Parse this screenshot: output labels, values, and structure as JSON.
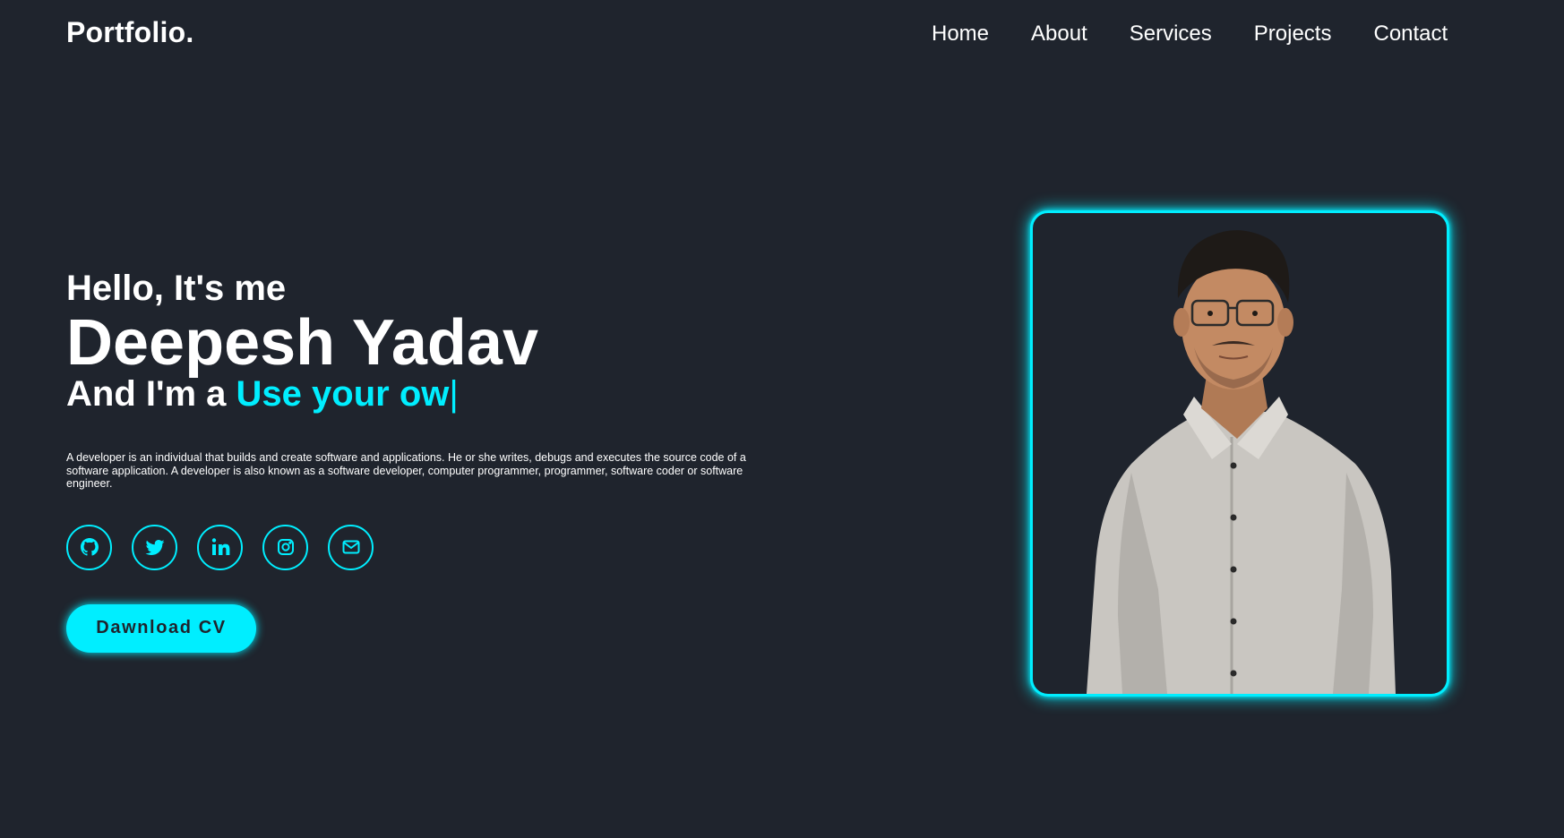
{
  "logo": "Portfolio.",
  "nav": {
    "items": [
      {
        "label": "Home"
      },
      {
        "label": "About"
      },
      {
        "label": "Services"
      },
      {
        "label": "Projects"
      },
      {
        "label": "Contact"
      }
    ]
  },
  "hero": {
    "greeting": "Hello, It's me",
    "name": "Deepesh Yadav",
    "role_prefix": "And I'm a ",
    "role_typed": "Use your ow",
    "cursor": "|",
    "description": "A developer is an individual that builds and create software and applications. He or she writes, debugs and executes the source code of a software application. A developer is also known as a software developer, computer programmer, programmer, software coder or software engineer.",
    "socials": [
      {
        "icon": "github-icon"
      },
      {
        "icon": "twitter-icon"
      },
      {
        "icon": "linkedin-icon"
      },
      {
        "icon": "instagram-icon"
      },
      {
        "icon": "mail-icon"
      }
    ],
    "cta_label": "Dawnload CV"
  },
  "colors": {
    "background": "#1f242d",
    "accent": "#00eeff",
    "text": "#ffffff"
  }
}
